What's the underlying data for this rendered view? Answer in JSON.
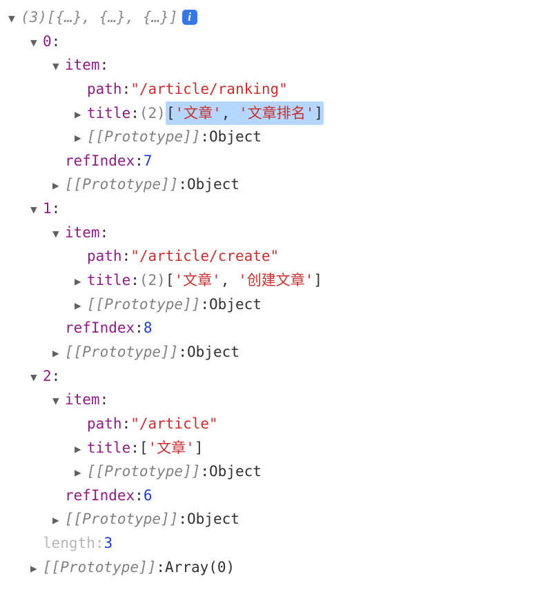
{
  "root": {
    "length_label": "(3)",
    "preview": "[{…}, {…}, {…}]",
    "info_icon": "i",
    "length_key": "length",
    "length_value": "3",
    "proto_key": "[[Prototype]]",
    "proto_value": "Array(0)",
    "items": [
      {
        "index": "0",
        "item_label": "item",
        "path_key": "path",
        "path_value": "\"/article/ranking\"",
        "title_key": "title",
        "title_count": "(2)",
        "title_open": "[",
        "title_vals": [
          "'文章'",
          "'文章排名'"
        ],
        "title_close": "]",
        "title_highlight": true,
        "item_proto_key": "[[Prototype]]",
        "item_proto_value": "Object",
        "refIndex_key": "refIndex",
        "refIndex_value": "7",
        "outer_proto_key": "[[Prototype]]",
        "outer_proto_value": "Object"
      },
      {
        "index": "1",
        "item_label": "item",
        "path_key": "path",
        "path_value": "\"/article/create\"",
        "title_key": "title",
        "title_count": "(2)",
        "title_open": "[",
        "title_vals": [
          "'文章'",
          "'创建文章'"
        ],
        "title_close": "]",
        "title_highlight": false,
        "item_proto_key": "[[Prototype]]",
        "item_proto_value": "Object",
        "refIndex_key": "refIndex",
        "refIndex_value": "8",
        "outer_proto_key": "[[Prototype]]",
        "outer_proto_value": "Object"
      },
      {
        "index": "2",
        "item_label": "item",
        "path_key": "path",
        "path_value": "\"/article\"",
        "title_key": "title",
        "title_count": "",
        "title_open": "[",
        "title_vals": [
          "'文章'"
        ],
        "title_close": "]",
        "title_highlight": false,
        "item_proto_key": "[[Prototype]]",
        "item_proto_value": "Object",
        "refIndex_key": "refIndex",
        "refIndex_value": "6",
        "outer_proto_key": "[[Prototype]]",
        "outer_proto_value": "Object"
      }
    ]
  }
}
